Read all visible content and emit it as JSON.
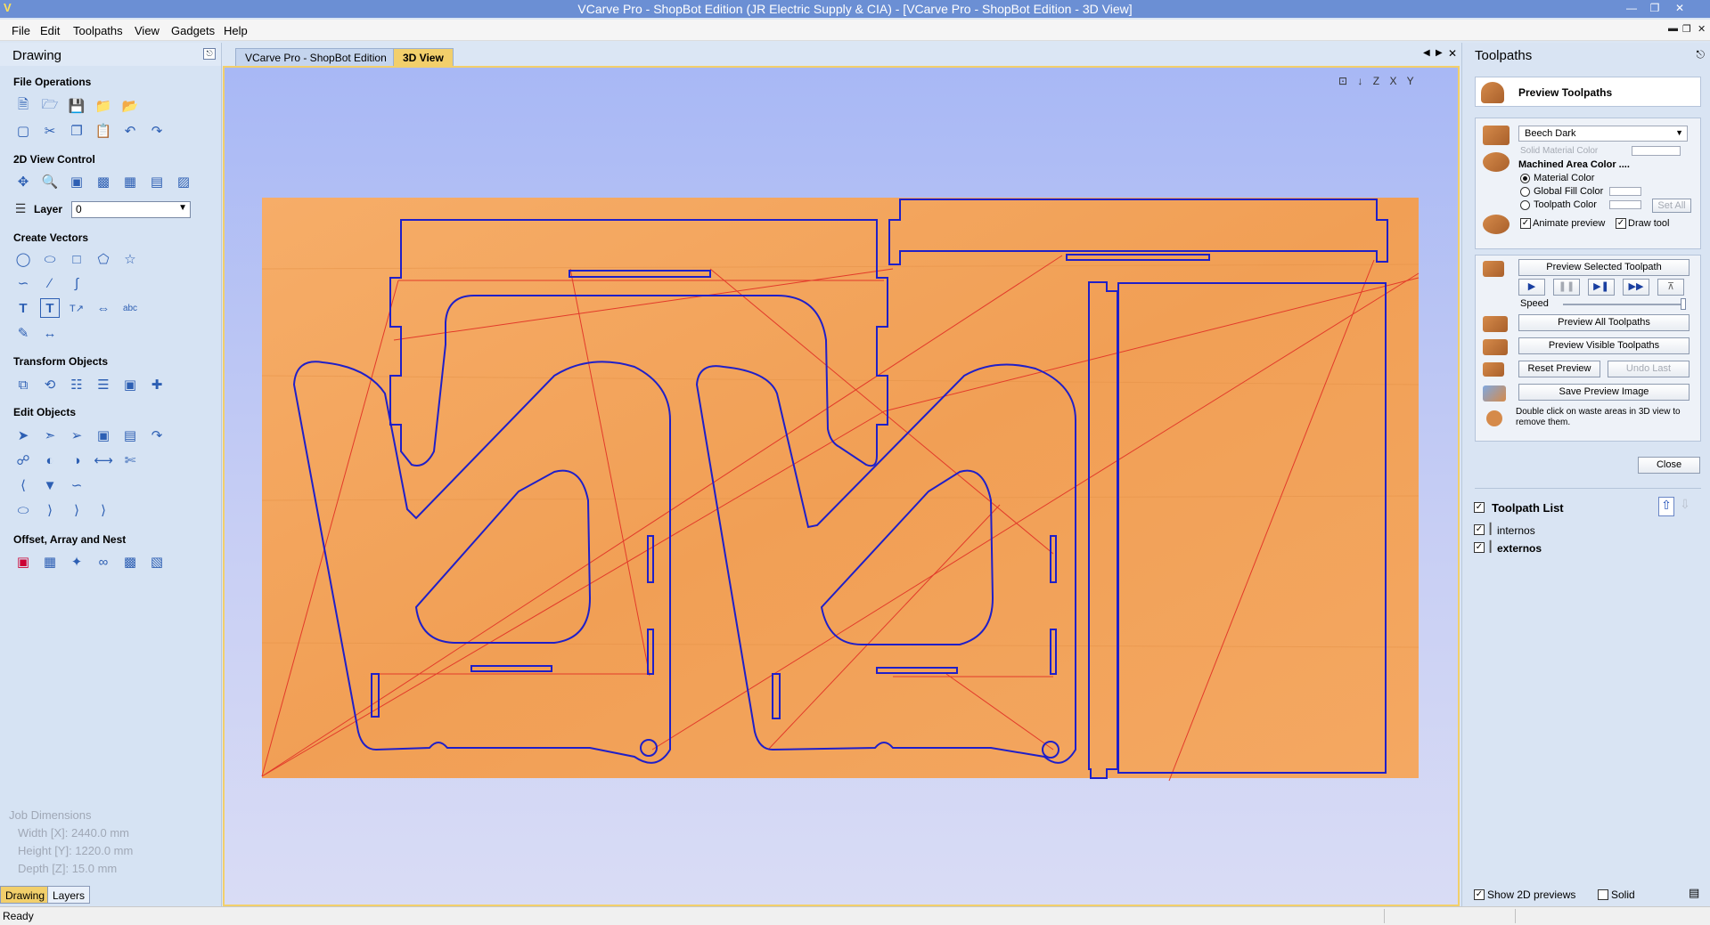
{
  "window": {
    "title": "VCarve Pro - ShopBot Edition (JR Electric Supply & CIA) - [VCarve Pro - ShopBot Edition - 3D View]",
    "logo": "V"
  },
  "menu": [
    "File",
    "Edit",
    "Toolpaths",
    "View",
    "Gadgets",
    "Help"
  ],
  "drawing_panel": {
    "title": "Drawing",
    "sections": {
      "file_operations": "File Operations",
      "view_control": "2D View Control",
      "create_vectors": "Create Vectors",
      "transform_objects": "Transform Objects",
      "edit_objects": "Edit Objects",
      "offset_array_nest": "Offset, Array and Nest"
    },
    "layer_label": "Layer",
    "layer_value": "0",
    "job_dimensions": {
      "title": "Job Dimensions",
      "width": "Width  [X]: 2440.0 mm",
      "height": "Height [Y]: 1220.0 mm",
      "depth": "Depth  [Z]: 15.0 mm"
    },
    "bottom_tabs": [
      "Drawing",
      "Layers"
    ]
  },
  "document_tabs": [
    "VCarve Pro - ShopBot Edition",
    "3D View"
  ],
  "view_icons": [
    "fit-view",
    "iso-view",
    "z-view",
    "x-view",
    "y-view"
  ],
  "view_icon_labels": [
    "⊡",
    "↓",
    "Z",
    "X",
    "Y"
  ],
  "toolpaths_panel": {
    "title": "Toolpaths",
    "preview_title": "Preview Toolpaths",
    "material": "Beech Dark",
    "solid_material_color": "Solid Material Color",
    "machined_area_color": "Machined Area Color ....",
    "radio_options": [
      "Material Color",
      "Global Fill Color",
      "Toolpath Color"
    ],
    "set_all": "Set All",
    "animate_preview": "Animate preview",
    "draw_tool": "Draw tool",
    "preview_selected": "Preview Selected Toolpath",
    "speed": "Speed",
    "preview_all": "Preview All Toolpaths",
    "preview_visible": "Preview Visible Toolpaths",
    "reset_preview": "Reset Preview",
    "undo_last": "Undo Last",
    "save_preview_image": "Save Preview Image",
    "hint": "Double click on waste areas in 3D view to remove them.",
    "close": "Close",
    "toolpath_list_title": "Toolpath List",
    "toolpaths": [
      "internos",
      "externos"
    ],
    "show_2d_previews": "Show 2D previews",
    "solid": "Solid"
  },
  "status": {
    "text": "Ready"
  },
  "colors": {
    "title_bar": "#6b8fd4",
    "wood": "#f3a55e",
    "cut_path": "#1f1fc8",
    "rapid_move": "#e23a2a",
    "active_tab": "#f2cf6b"
  }
}
